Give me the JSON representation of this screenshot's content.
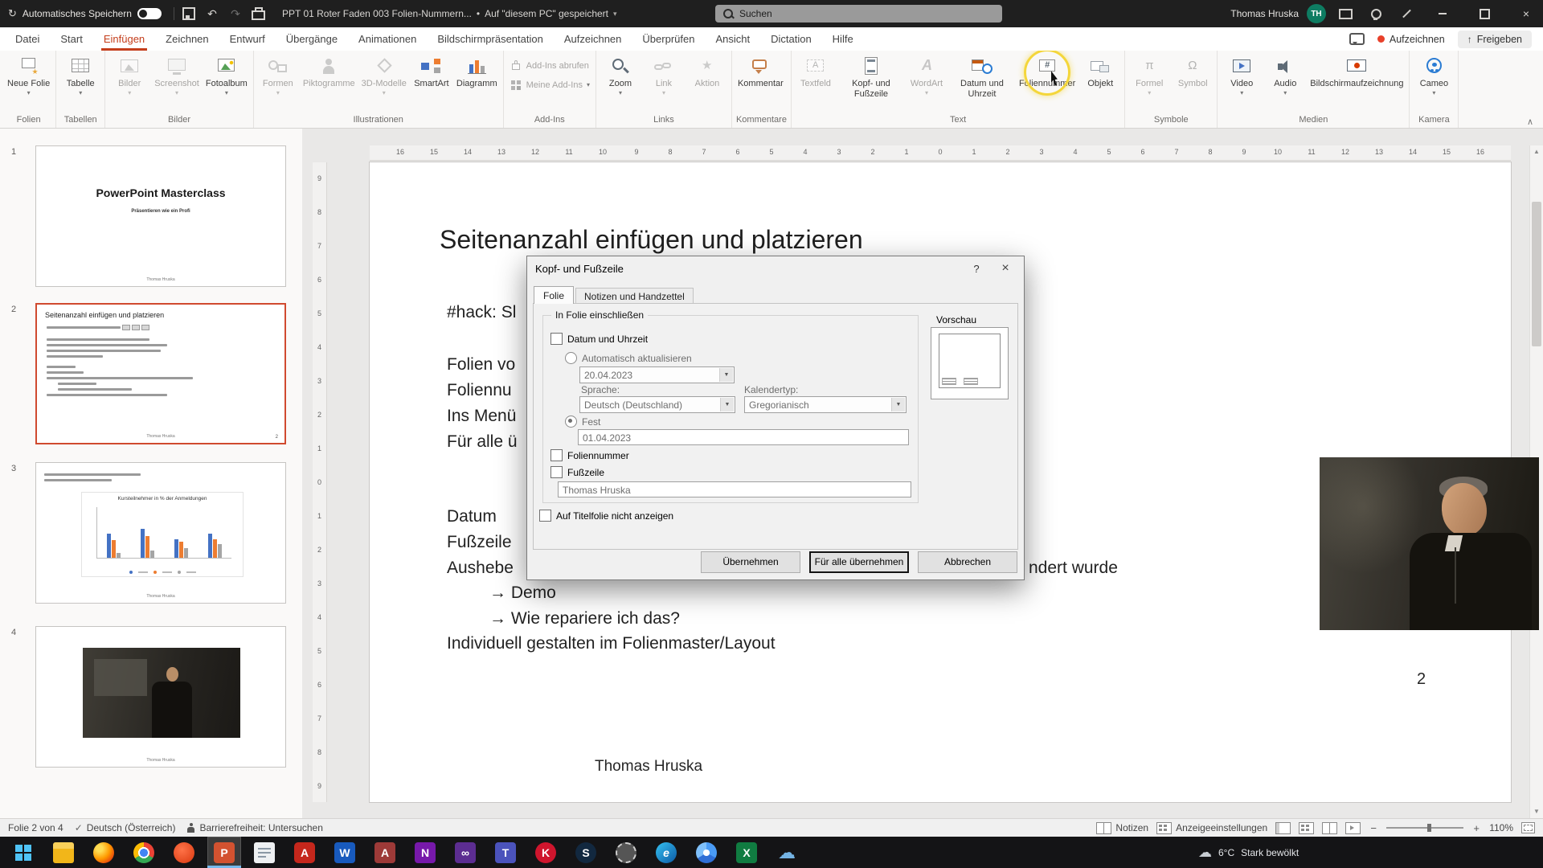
{
  "titlebar": {
    "autosave_label": "Automatisches Speichern",
    "filename": "PPT 01 Roter Faden 003 Folien-Nummern...",
    "separator": "•",
    "saved_status": "Auf \"diesem PC\" gespeichert",
    "search_placeholder": "Suchen",
    "user_name": "Thomas Hruska",
    "user_initials": "TH"
  },
  "ribbon": {
    "tabs": [
      "Datei",
      "Start",
      "Einfügen",
      "Zeichnen",
      "Entwurf",
      "Übergänge",
      "Animationen",
      "Bildschirmpräsentation",
      "Aufzeichnen",
      "Überprüfen",
      "Ansicht",
      "Dictation",
      "Hilfe"
    ],
    "active_tab": "Einfügen",
    "record_button": "Aufzeichnen",
    "share_button": "Freigeben",
    "groups": [
      {
        "label": "Folien",
        "buttons": [
          {
            "label": "Neue Folie",
            "icon": "new-slide",
            "dropdown": true
          }
        ]
      },
      {
        "label": "Tabellen",
        "buttons": [
          {
            "label": "Tabelle",
            "icon": "table",
            "dropdown": true
          }
        ]
      },
      {
        "label": "Bilder",
        "buttons": [
          {
            "label": "Bilder",
            "icon": "pictures",
            "dropdown": true,
            "disabled": true
          },
          {
            "label": "Screenshot",
            "icon": "screenshot",
            "dropdown": true,
            "disabled": true
          },
          {
            "label": "Fotoalbum",
            "icon": "photo-album",
            "dropdown": true
          }
        ]
      },
      {
        "label": "Illustrationen",
        "buttons": [
          {
            "label": "Formen",
            "icon": "shapes",
            "dropdown": true,
            "disabled": true
          },
          {
            "label": "Piktogramme",
            "icon": "pictograms",
            "disabled": true
          },
          {
            "label": "3D-Modelle",
            "icon": "3d-models",
            "dropdown": true,
            "disabled": true
          },
          {
            "label": "SmartArt",
            "icon": "smartart"
          },
          {
            "label": "Diagramm",
            "icon": "chart"
          }
        ]
      },
      {
        "label": "Add-Ins",
        "stack": [
          {
            "label": "Add-Ins abrufen",
            "icon": "store",
            "disabled": true
          },
          {
            "label": "Meine Add-Ins",
            "icon": "my-addins",
            "dropdown": true,
            "disabled": true
          }
        ]
      },
      {
        "label": "Links",
        "buttons": [
          {
            "label": "Zoom",
            "icon": "zoom",
            "dropdown": true
          },
          {
            "label": "Link",
            "icon": "link",
            "dropdown": true,
            "disabled": true
          },
          {
            "label": "Aktion",
            "icon": "action",
            "disabled": true
          }
        ]
      },
      {
        "label": "Kommentare",
        "buttons": [
          {
            "label": "Kommentar",
            "icon": "comment"
          }
        ]
      },
      {
        "label": "Text",
        "buttons": [
          {
            "label": "Textfeld",
            "icon": "textbox",
            "disabled": true
          },
          {
            "label": "Kopf- und Fußzeile",
            "icon": "header-footer"
          },
          {
            "label": "WordArt",
            "icon": "wordart",
            "dropdown": true,
            "disabled": true
          },
          {
            "label": "Datum und Uhrzeit",
            "icon": "datetime"
          },
          {
            "label": "Foliennummer",
            "icon": "slide-number",
            "highlight": true
          },
          {
            "label": "Objekt",
            "icon": "object"
          }
        ]
      },
      {
        "label": "Symbole",
        "buttons": [
          {
            "label": "Formel",
            "icon": "formula",
            "dropdown": true,
            "disabled": true
          },
          {
            "label": "Symbol",
            "icon": "symbol",
            "disabled": true
          }
        ]
      },
      {
        "label": "Medien",
        "buttons": [
          {
            "label": "Video",
            "icon": "video",
            "dropdown": true
          },
          {
            "label": "Audio",
            "icon": "audio",
            "dropdown": true
          },
          {
            "label": "Bildschirmaufzeichnung",
            "icon": "screen-recording"
          }
        ]
      },
      {
        "label": "Kamera",
        "buttons": [
          {
            "label": "Cameo",
            "icon": "cameo",
            "dropdown": true
          }
        ]
      }
    ]
  },
  "slide_panel": {
    "thumbnails": [
      {
        "number": "1",
        "type": "title",
        "title": "PowerPoint Masterclass",
        "subtitle": "Präsentieren wie ein Profi",
        "footer": "Thomas Hruska"
      },
      {
        "number": "2",
        "type": "content",
        "selected": true,
        "title": "Seitenanzahl einfügen und platzieren",
        "footer": "Thomas Hruska",
        "page_number": "2"
      },
      {
        "number": "3",
        "type": "chart",
        "chart_title": "Kursteilnehmer in % der Anmeldungen",
        "footer": "Thomas Hruska"
      },
      {
        "number": "4",
        "type": "picture",
        "footer": "Thomas Hruska"
      }
    ]
  },
  "slide": {
    "title": "Seitenanzahl einfügen und platzieren",
    "body_lines": [
      "#hack: Sl",
      "Folien vo",
      "Foliennu",
      "Ins Menü",
      "Für alle ü",
      "Datum",
      "Fußzeile",
      "Aushebe",
      "→ Demo",
      "→ Wie repariere ich das?",
      "Individuell gestalten im Folienmaster/Layout"
    ],
    "covered_fragment": "ndert wurde",
    "footer": "Thomas Hruska",
    "page_number": "2"
  },
  "dialog": {
    "title": "Kopf- und Fußzeile",
    "help": "?",
    "close": "×",
    "tabs": [
      "Folie",
      "Notizen und Handzettel"
    ],
    "active_tab": "Folie",
    "include_group_label": "In Folie einschließen",
    "date_checkbox_label": "Datum und Uhrzeit",
    "auto_update_label": "Automatisch aktualisieren",
    "auto_date_value": "20.04.2023",
    "language_label": "Sprache:",
    "language_value": "Deutsch (Deutschland)",
    "calendar_label": "Kalendertyp:",
    "calendar_value": "Gregorianisch",
    "fixed_label": "Fest",
    "fixed_date_value": "01.04.2023",
    "slide_number_checkbox_label": "Foliennummer",
    "footer_checkbox_label": "Fußzeile",
    "footer_value": "Thomas Hruska",
    "title_slide_checkbox_label": "Auf Titelfolie nicht anzeigen",
    "preview_label": "Vorschau",
    "apply_button": "Übernehmen",
    "apply_all_button": "Für alle übernehmen",
    "cancel_button": "Abbrechen"
  },
  "statusbar": {
    "slide_info": "Folie 2 von 4",
    "language": "Deutsch (Österreich)",
    "accessibility": "Barrierefreiheit: Untersuchen",
    "notes": "Notizen",
    "display_settings": "Anzeigeeinstellungen",
    "zoom_level": "110%"
  },
  "taskbar": {
    "weather": {
      "temperature": "6°C",
      "condition": "Stark bewölkt"
    },
    "apps": [
      {
        "name": "start"
      },
      {
        "name": "file-explorer"
      },
      {
        "name": "firefox"
      },
      {
        "name": "chrome"
      },
      {
        "name": "brave"
      },
      {
        "name": "powerpoint",
        "active": true,
        "glyph": "P"
      },
      {
        "name": "notepad"
      },
      {
        "name": "acrobat",
        "glyph": "A"
      },
      {
        "name": "word",
        "glyph": "W"
      },
      {
        "name": "access",
        "glyph": "A"
      },
      {
        "name": "onenote",
        "glyph": "N"
      },
      {
        "name": "visual-studio",
        "glyph": "∞"
      },
      {
        "name": "teams",
        "glyph": "T"
      },
      {
        "name": "keeper",
        "glyph": "K"
      },
      {
        "name": "steam",
        "glyph": "S"
      },
      {
        "name": "settings"
      },
      {
        "name": "edge",
        "glyph": "e"
      },
      {
        "name": "chromium"
      },
      {
        "name": "excel",
        "glyph": "X"
      },
      {
        "name": "onedrive",
        "glyph": "☁"
      }
    ]
  },
  "rulers": {
    "horizontal": [
      "16",
      "15",
      "14",
      "13",
      "12",
      "11",
      "10",
      "9",
      "8",
      "7",
      "6",
      "5",
      "4",
      "3",
      "2",
      "1",
      "0",
      "1",
      "2",
      "3",
      "4",
      "5",
      "6",
      "7",
      "8",
      "9",
      "10",
      "11",
      "12",
      "13",
      "14",
      "15",
      "16"
    ],
    "vertical": [
      "9",
      "8",
      "7",
      "6",
      "5",
      "4",
      "3",
      "2",
      "1",
      "0",
      "1",
      "2",
      "3",
      "4",
      "5",
      "6",
      "7",
      "8",
      "9"
    ]
  },
  "glyphs": {
    "dropdown": "▾",
    "combo_arrow": "▼",
    "scroll_up": "▲",
    "scroll_down": "▼",
    "collapse": "∧",
    "undo": "↶",
    "redo": "↷",
    "sync": "↻",
    "share_arrow": "↑",
    "proofing_check": "✓",
    "title_chevron": "▾"
  },
  "colors": {
    "accent": "#c43e1c",
    "selection_border": "#d04a2f",
    "highlight_ring": "#f4d63b"
  }
}
